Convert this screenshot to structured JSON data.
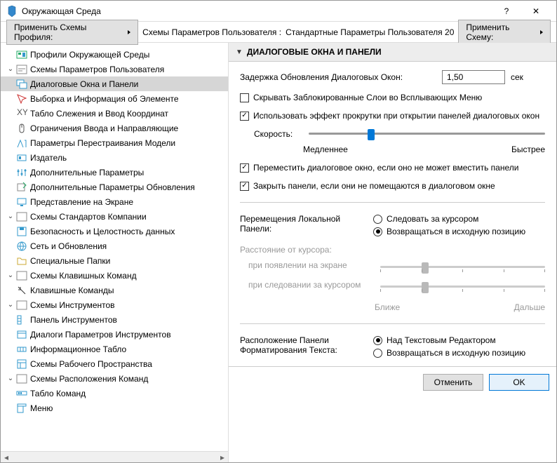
{
  "window": {
    "title": "Окружающая Среда"
  },
  "toolbar": {
    "apply_profile": "Применить Схемы Профиля:",
    "user_params_label": "Схемы Параметров Пользователя :",
    "user_params_value": "Стандартные Параметры Пользователя 20",
    "apply_scheme": "Применить Схему:"
  },
  "tree": {
    "rootProfiles": "Профили Окружающей Среды",
    "userSchemes": "Схемы Параметров Пользователя",
    "dialogs": "Диалоговые Окна и Панели",
    "selection": "Выборка и Информация об Элементе",
    "tracker": "Табло Слежения и Ввод Координат",
    "constraints": "Ограничения Ввода и Направляющие",
    "rebuild": "Параметры Перестраивания Модели",
    "publisher": "Издатель",
    "addParams": "Дополнительные Параметры",
    "updateParams": "Дополнительные Параметры Обновления",
    "display": "Представление на Экране",
    "companySchemes": "Схемы Стандартов Компании",
    "security": "Безопасность и Целостность данных",
    "network": "Сеть и Обновления",
    "specialFolders": "Специальные Папки",
    "keyboardSchemes": "Схемы Клавишных Команд",
    "keyboardCommands": "Клавишные Команды",
    "toolSchemes": "Схемы Инструментов",
    "toolbar": "Панель Инструментов",
    "toolDialogs": "Диалоги Параметров Инструментов",
    "infoBoard": "Информационное Табло",
    "workspaceSchemes": "Схемы Рабочего Пространства",
    "commandSchemes": "Схемы Расположения Команд",
    "commandBoard": "Табло Команд",
    "menu": "Меню"
  },
  "section": {
    "title": "ДИАЛОГОВЫЕ ОКНА И ПАНЕЛИ"
  },
  "form": {
    "delay_label": "Задержка Обновления Диалоговых Окон:",
    "delay_value": "1,50",
    "delay_unit": "сек",
    "hide_locked": "Скрывать Заблокированные Слои во Всплывающих Меню",
    "use_scroll": "Использовать эффект прокрутки при открытии панелей диалоговых окон",
    "speed_label": "Скорость:",
    "slower": "Медленнее",
    "faster": "Быстрее",
    "move_dialog": "Переместить диалоговое окно, если оно не может вместить панели",
    "close_panels": "Закрыть панели, если они не помещаются в диалоговом окне",
    "local_panel": "Перемещения Локальной Панели:",
    "follow_cursor": "Следовать за курсором",
    "return_pos": "Возвращаться в исходную позицию",
    "cursor_dist": "Расстояние от курсора:",
    "on_screen": "при появлении на экране",
    "on_follow": "при следовании за курсором",
    "closer": "Ближе",
    "farther": "Дальше",
    "text_panel": "Расположение Панели Форматирования Текста:",
    "above_editor": "Над Текстовым Редактором",
    "return_pos2": "Возвращаться в исходную позицию"
  },
  "buttons": {
    "cancel": "Отменить",
    "ok": "OK"
  }
}
